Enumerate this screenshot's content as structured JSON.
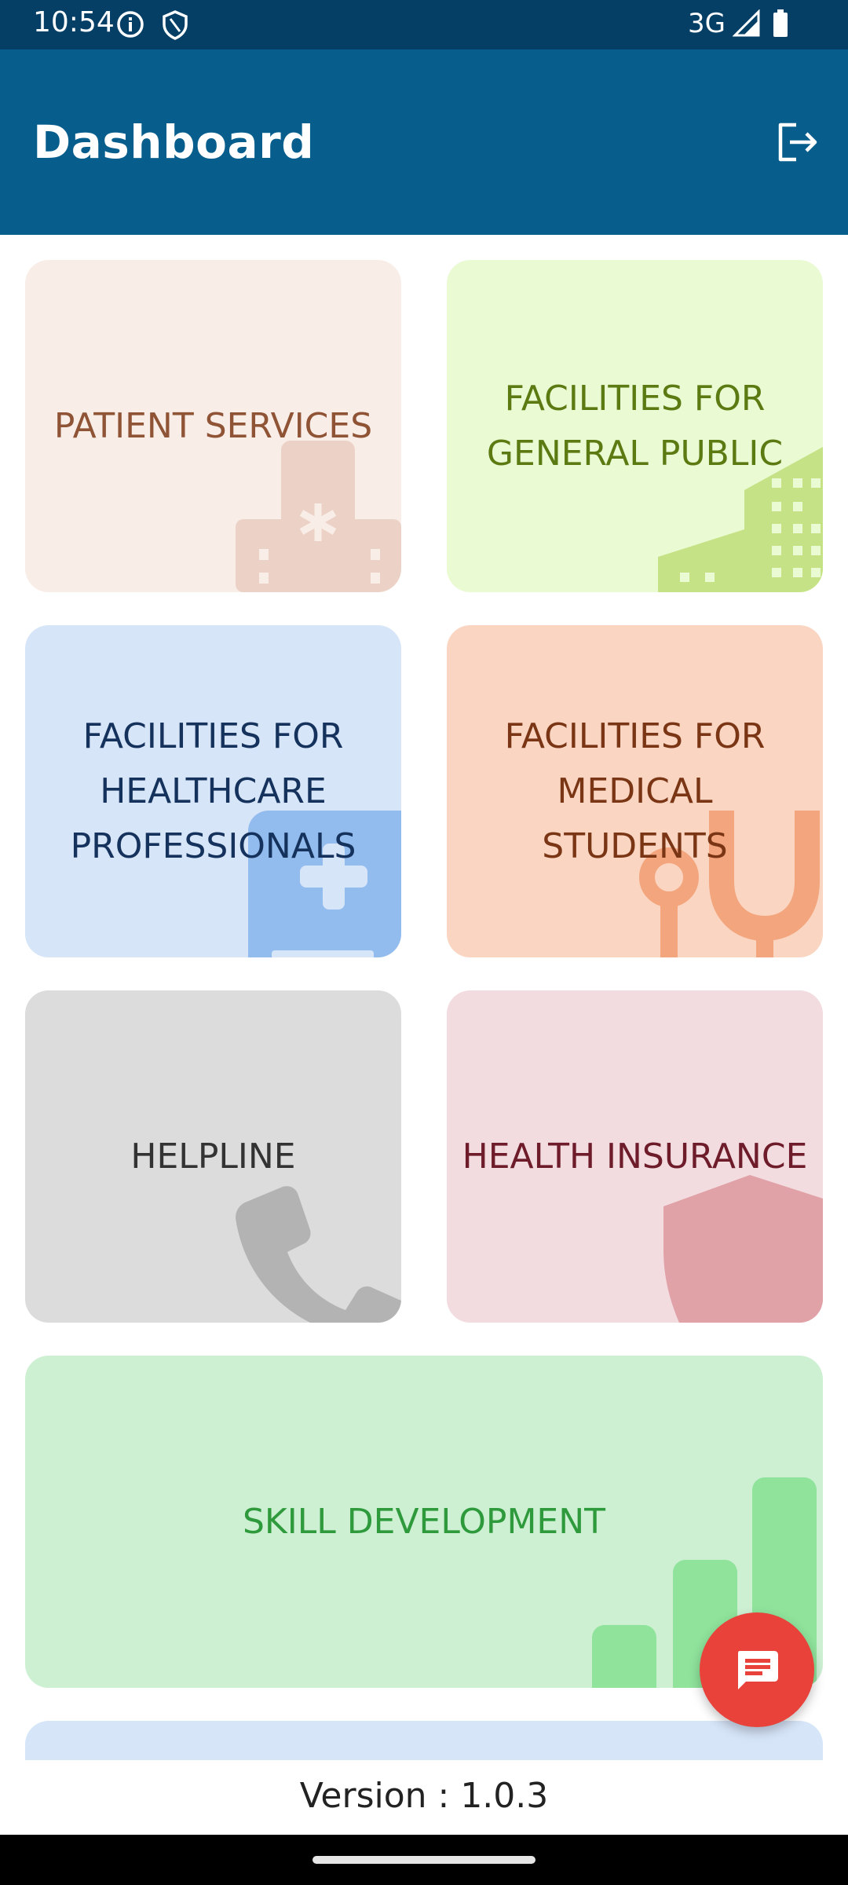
{
  "status_bar": {
    "time": "10:54",
    "network": "3G"
  },
  "app_bar": {
    "title": "Dashboard"
  },
  "tiles": [
    {
      "label": "PATIENT SERVICES",
      "bg": "#f9ede7",
      "color": "#8f5335",
      "icon": "hospital-icon"
    },
    {
      "label": "FACILITIES FOR GENERAL PUBLIC",
      "bg": "#eafad3",
      "color": "#5b7a12",
      "icon": "building-icon"
    },
    {
      "label": "FACILITIES FOR HEALTHCARE PROFESSIONALS",
      "bg": "#d7e5f9",
      "color": "#14325c",
      "icon": "medical-kit-icon"
    },
    {
      "label": "FACILITIES FOR MEDICAL STUDENTS",
      "bg": "#fad6c2",
      "color": "#7a3515",
      "icon": "stethoscope-icon"
    },
    {
      "label": "HELPLINE",
      "bg": "#dcdcdc",
      "color": "#333333",
      "icon": "phone-icon"
    },
    {
      "label": "HEALTH INSURANCE",
      "bg": "#f2dce0",
      "color": "#6e1c2a",
      "icon": "shield-icon"
    },
    {
      "label": "SKILL DEVELOPMENT",
      "bg": "#cdf0d3",
      "color": "#2e9a3c",
      "icon": "bar-chart-icon"
    }
  ],
  "footer": {
    "version": "Version : 1.0.3"
  },
  "fab": {
    "icon": "chat-icon"
  }
}
